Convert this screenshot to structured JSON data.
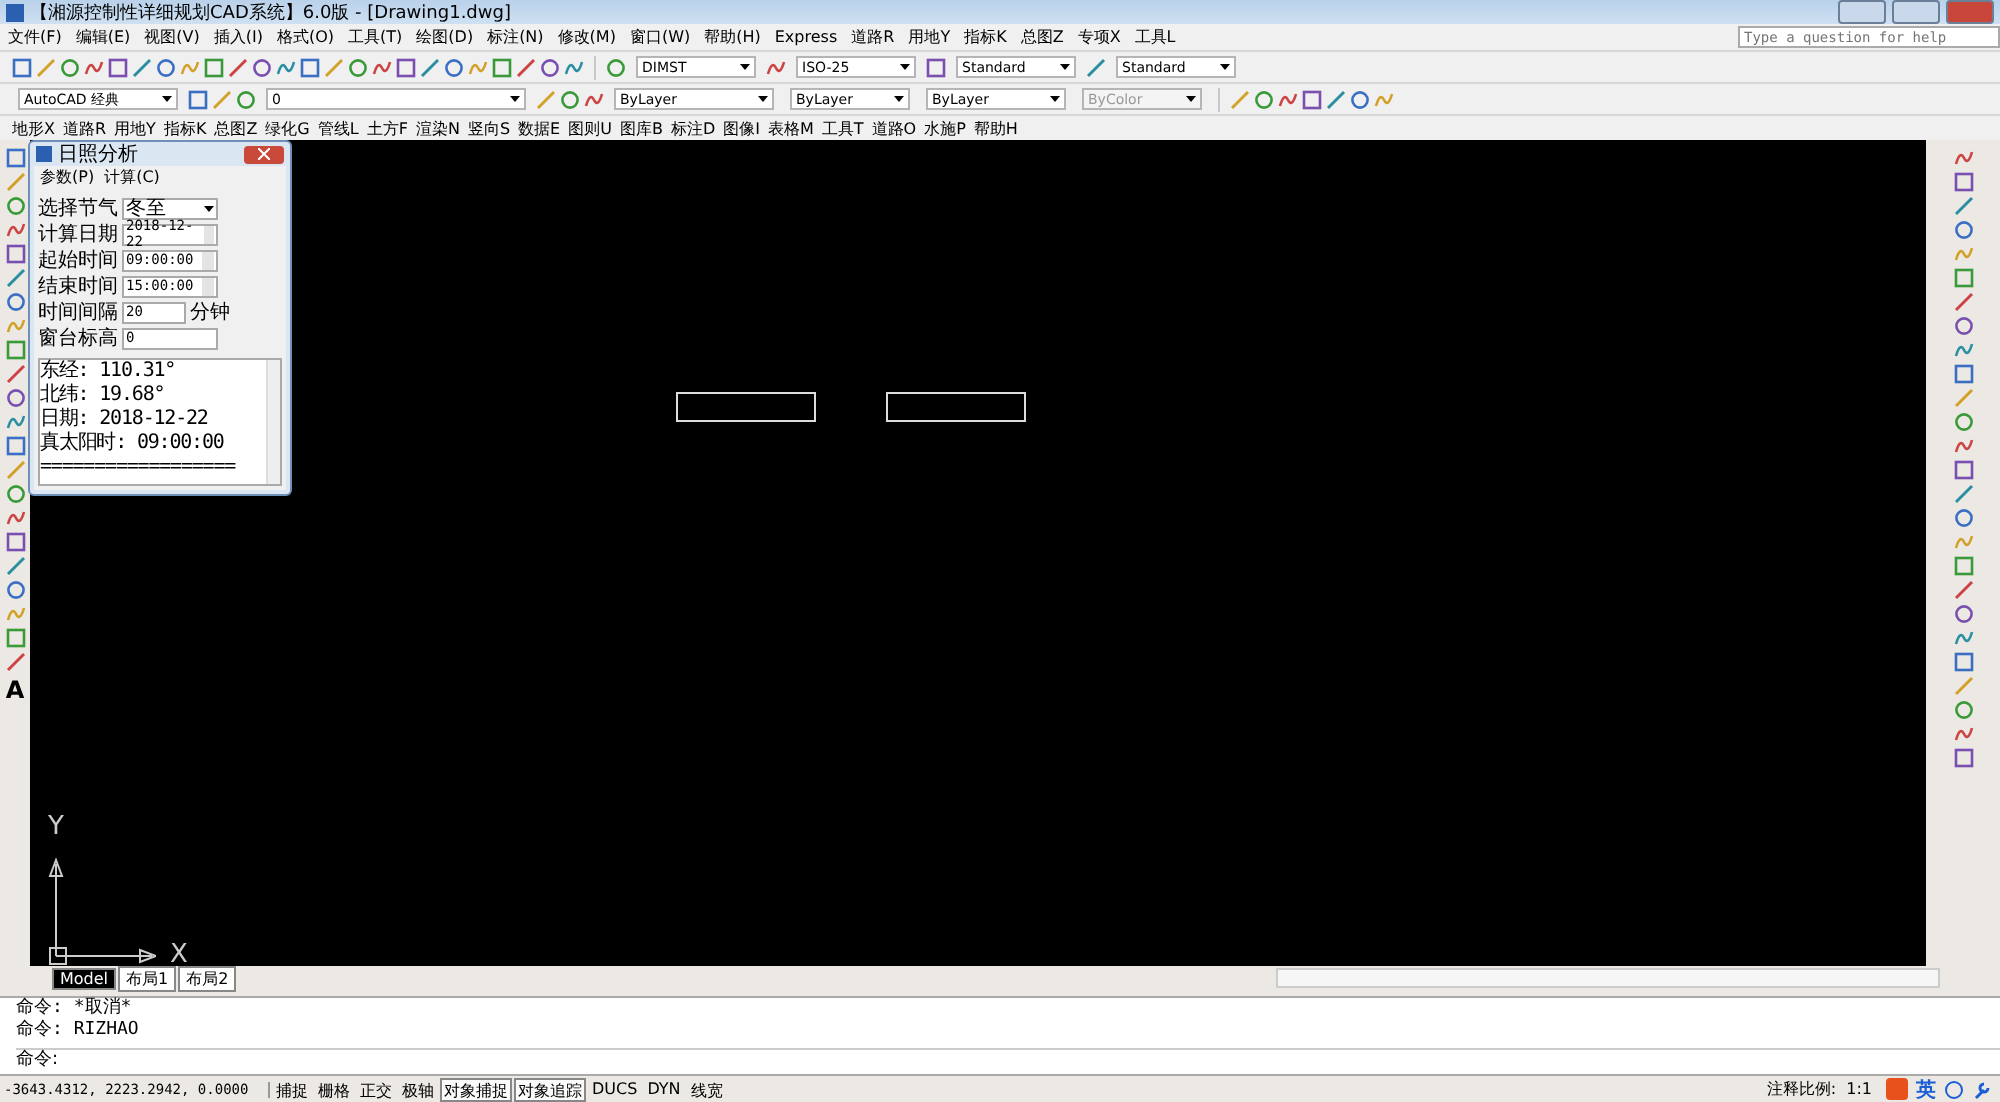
{
  "window": {
    "title": "【湘源控制性详细规划CAD系统】6.0版 - [Drawing1.dwg]"
  },
  "menu": [
    "文件(F)",
    "编辑(E)",
    "视图(V)",
    "插入(I)",
    "格式(O)",
    "工具(T)",
    "绘图(D)",
    "标注(N)",
    "修改(M)",
    "窗口(W)",
    "帮助(H)",
    "Express",
    "道路R",
    "用地Y",
    "指标K",
    "总图Z",
    "专项X",
    "工具L"
  ],
  "help_search": {
    "placeholder": "Type a question for help"
  },
  "toolbar_1_dropdowns": [
    {
      "value": "DIMST",
      "disabled": false
    },
    {
      "value": "ISO-25",
      "disabled": false
    },
    {
      "value": "Standard",
      "disabled": false
    },
    {
      "value": "Standard",
      "disabled": false
    }
  ],
  "toolbar_2_dropdowns": [
    {
      "value": "AutoCAD 经典",
      "disabled": false
    },
    {
      "value": "0",
      "disabled": false
    },
    {
      "value": "ByLayer",
      "disabled": false
    },
    {
      "value": "ByLayer",
      "disabled": false
    },
    {
      "value": "ByLayer",
      "disabled": false
    },
    {
      "value": "ByColor",
      "disabled": true
    }
  ],
  "app_menu": [
    "地形X",
    "道路R",
    "用地Y",
    "指标K",
    "总图Z",
    "绿化G",
    "管线L",
    "土方F",
    "渲染N",
    "竖向S",
    "数据E",
    "图则U",
    "图库B",
    "标注D",
    "图像I",
    "表格M",
    "工具T",
    "道路O",
    "水施P",
    "帮助H"
  ],
  "left_toolbar": {
    "text_tool_glyph": "A"
  },
  "dialog": {
    "title": "日照分析",
    "menu": [
      "参数(P)",
      "计算(C)"
    ],
    "fields": [
      {
        "label": "选择节气",
        "value": "冬至",
        "kind": "select"
      },
      {
        "label": "计算日期",
        "value": "2018-12-22",
        "kind": "spin"
      },
      {
        "label": "起始时间",
        "value": "09:00:00",
        "kind": "spin"
      },
      {
        "label": "结束时间",
        "value": "15:00:00",
        "kind": "spin"
      },
      {
        "label": "时间间隔",
        "value": "20",
        "kind": "unit",
        "unit": "分钟"
      },
      {
        "label": "窗台标高",
        "value": "0",
        "kind": "text"
      }
    ],
    "output": [
      "东经: 110.31°",
      "北纬: 19.68°",
      "日期: 2018-12-22",
      "真太阳时: 09:00:00",
      "=================="
    ]
  },
  "canvas": {
    "axis_y": "Y",
    "axis_x": "X"
  },
  "layout_tabs": [
    {
      "label": "Model",
      "selected": true
    },
    {
      "label": "布局1",
      "selected": false
    },
    {
      "label": "布局2",
      "selected": false
    }
  ],
  "command_lines": [
    "命令: *取消*",
    "命令: RIZHAO"
  ],
  "command_prompt": "命令:",
  "status_bar": {
    "coordinates": "-3643.4312, 2223.2942, 0.0000",
    "toggles": [
      {
        "label": "捕捉",
        "on": false
      },
      {
        "label": "栅格",
        "on": false
      },
      {
        "label": "正交",
        "on": false
      },
      {
        "label": "极轴",
        "on": false
      },
      {
        "label": "对象捕捉",
        "on": true
      },
      {
        "label": "对象追踪",
        "on": true
      },
      {
        "label": "DUCS",
        "on": false
      },
      {
        "label": "DYN",
        "on": false
      },
      {
        "label": "线宽",
        "on": false
      }
    ],
    "annotation_scale_label": "注释比例:",
    "annotation_scale": "1:1",
    "ime_label": "英"
  }
}
